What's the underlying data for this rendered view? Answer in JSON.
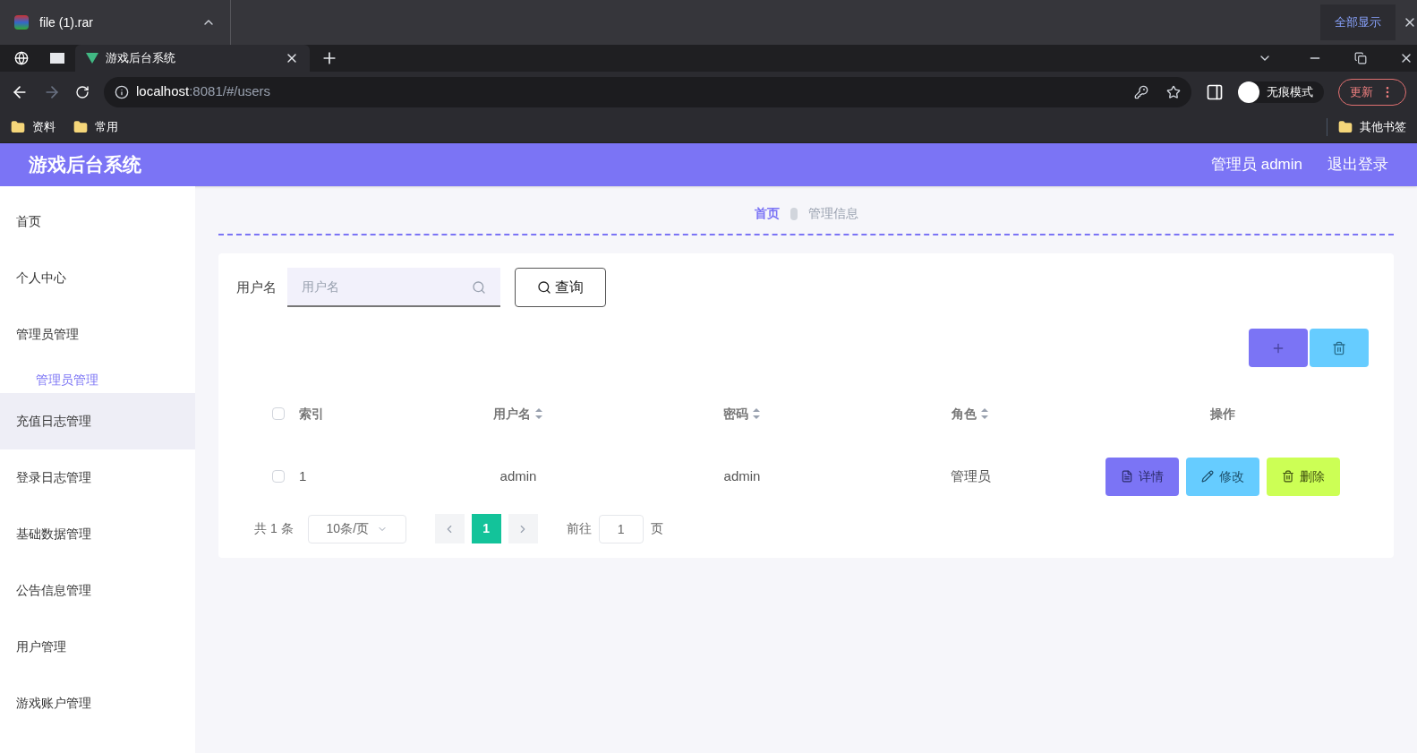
{
  "download_bar": {
    "file": "file (1).rar",
    "show_all": "全部显示"
  },
  "browser": {
    "tab_title": "游戏后台系统",
    "url_host": "localhost",
    "url_rest": ":8081/#/users",
    "incognito": "无痕模式",
    "update": "更新",
    "bookmarks": [
      "资料",
      "常用"
    ],
    "other_bookmarks": "其他书签"
  },
  "header": {
    "title": "游戏后台系统",
    "user": "管理员 admin",
    "logout": "退出登录"
  },
  "sidebar": {
    "items": [
      {
        "label": "首页",
        "highlighted": false
      },
      {
        "label": "个人中心",
        "highlighted": false
      },
      {
        "label": "管理员管理",
        "highlighted": false,
        "children": [
          {
            "label": "管理员管理"
          }
        ]
      },
      {
        "label": "充值日志管理",
        "highlighted": true
      },
      {
        "label": "登录日志管理",
        "highlighted": false
      },
      {
        "label": "基础数据管理",
        "highlighted": false
      },
      {
        "label": "公告信息管理",
        "highlighted": false
      },
      {
        "label": "用户管理",
        "highlighted": false
      },
      {
        "label": "游戏账户管理",
        "highlighted": false
      }
    ]
  },
  "breadcrumb": [
    "首页",
    "管理信息"
  ],
  "search": {
    "label": "用户名",
    "placeholder": "用户名",
    "button": "查询"
  },
  "table": {
    "select_all_checked": false,
    "columns": [
      {
        "label": "索引",
        "sortable": false
      },
      {
        "label": "用户名",
        "sortable": true
      },
      {
        "label": "密码",
        "sortable": true
      },
      {
        "label": "角色",
        "sortable": true
      },
      {
        "label": "操作",
        "sortable": false
      }
    ],
    "rows": [
      {
        "checked": false,
        "cells": [
          "1",
          "admin",
          "admin",
          "管理员"
        ],
        "actions": [
          "详情",
          "修改",
          "删除"
        ]
      }
    ]
  },
  "pagination": {
    "total": "共 1 条",
    "page_size": "10条/页",
    "pages": [
      {
        "label": "1",
        "selected": true
      }
    ],
    "goto_label": "前往",
    "goto_value": "1",
    "page_suffix": "页"
  }
}
